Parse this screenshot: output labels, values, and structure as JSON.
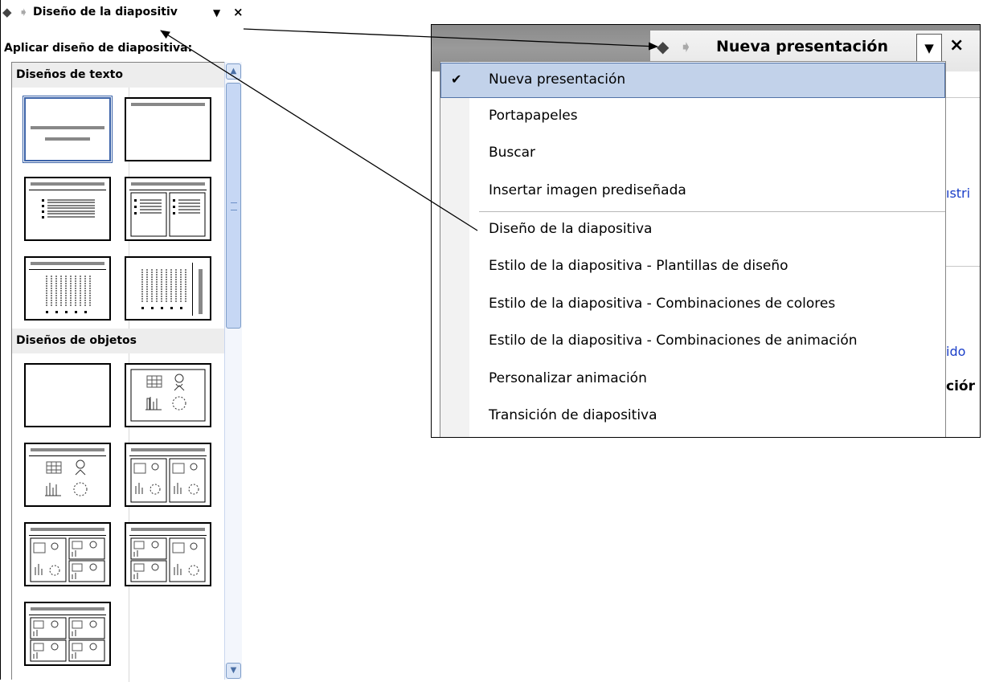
{
  "left_pane": {
    "title": "Diseño de la diapositiv",
    "back_glyph": "🡄",
    "dropdown_glyph": "▼",
    "close_glyph": "×",
    "subtitle": "Aplicar diseño de diapositiva:",
    "sections": [
      {
        "label": "Diseños de texto"
      },
      {
        "label": "Diseños de objetos"
      }
    ],
    "text_layouts": [
      {
        "name": "Diapositiva de título",
        "selected": true
      },
      {
        "name": "Sólo el título",
        "selected": false
      },
      {
        "name": "Título y texto",
        "selected": false
      },
      {
        "name": "Título y texto en 2 columnas",
        "selected": false
      },
      {
        "name": "Título y texto vertical",
        "selected": false
      },
      {
        "name": "Título vertical y texto",
        "selected": false
      }
    ],
    "object_layouts": [
      {
        "name": "En blanco"
      },
      {
        "name": "Contenido"
      },
      {
        "name": "Título y contenido"
      },
      {
        "name": "Título y 2 contenidos"
      },
      {
        "name": "Título, contenido y 2 contenidos"
      },
      {
        "name": "Título, 2 contenidos y contenido"
      },
      {
        "name": "Título y 4 contenidos"
      }
    ],
    "scroll": {
      "up": "▲",
      "down": "▼"
    }
  },
  "popup": {
    "title": "Nueva presentación",
    "dropdown_glyph": "▼",
    "close_glyph": "×",
    "check_glyph": "✔",
    "items": [
      {
        "label": "Nueva presentación",
        "selected": true
      },
      {
        "label": "Portapapeles",
        "selected": false
      },
      {
        "label": "Buscar",
        "selected": false
      },
      {
        "label": "Insertar imagen prediseñada",
        "selected": false
      },
      {
        "label": "Diseño de la diapositiva",
        "selected": false
      },
      {
        "label": "Estilo de la diapositiva - Plantillas de diseño",
        "selected": false
      },
      {
        "label": "Estilo de la diapositiva - Combinaciones de colores",
        "selected": false
      },
      {
        "label": "Estilo de la diapositiva - Combinaciones de animación",
        "selected": false
      },
      {
        "label": "Personalizar animación",
        "selected": false
      },
      {
        "label": "Transición de diapositiva",
        "selected": false
      }
    ],
    "background_text": [
      "ıstri",
      "ido",
      "ciór"
    ]
  },
  "colors": {
    "selection_fill": "#c2d2ea",
    "selection_border": "#5273a8",
    "link_blue": "#1a3ec8",
    "scrollbar": "#c6d7f4"
  }
}
